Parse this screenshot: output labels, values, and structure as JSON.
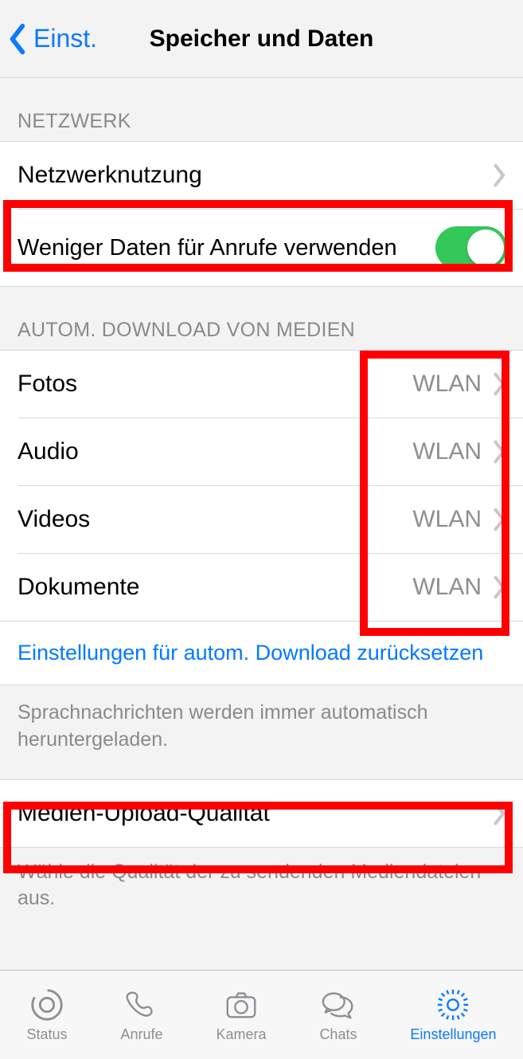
{
  "header": {
    "back_label": "Einst.",
    "title": "Speicher und Daten"
  },
  "sections": {
    "network_header": "NETZWERK",
    "network_usage": "Netzwerknutzung",
    "less_data_calls": "Weniger Daten für Anrufe verwenden",
    "auto_dl_header": "AUTOM. DOWNLOAD VON MEDIEN",
    "media_rows": [
      {
        "label": "Fotos",
        "value": "WLAN"
      },
      {
        "label": "Audio",
        "value": "WLAN"
      },
      {
        "label": "Videos",
        "value": "WLAN"
      },
      {
        "label": "Dokumente",
        "value": "WLAN"
      }
    ],
    "reset_label": "Einstellungen für autom. Download zurücksetzen",
    "voice_note": "Sprachnachrichten werden immer automatisch heruntergeladen.",
    "upload_quality": "Medien-Upload-Qualität",
    "upload_note": "Wähle die Qualität der zu sendenden Mediendateien aus."
  },
  "tabs": {
    "status": "Status",
    "calls": "Anrufe",
    "camera": "Kamera",
    "chats": "Chats",
    "settings": "Einstellungen"
  }
}
